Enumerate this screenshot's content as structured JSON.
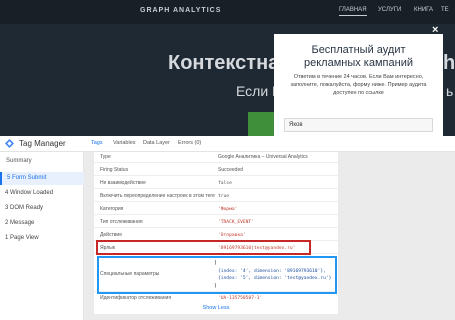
{
  "site": {
    "logo": "GRAPH ANALYTICS",
    "menu": [
      "ГЛАВНАЯ",
      "УСЛУГИ",
      "КНИГА",
      "ТЕ"
    ],
    "hero_title": "Контекстна",
    "hero_title_tail": "h",
    "hero_subtitle": "Если В",
    "hero_subtitle_tail": "ь"
  },
  "popup": {
    "close": "×",
    "heading_line1": "Бесплатный аудит",
    "heading_line2": "рекламных кампаний",
    "text_line1": "Ответим в течение 24 часов. Если Вам интересно,",
    "text_line2": "заполните, пожалуйста, форму ниже. Пример аудита",
    "text_line3": "доступен по ссылке",
    "input_value": "Яков"
  },
  "gtm": {
    "title": "Tag Manager",
    "tabs": [
      "Tags",
      "Variables",
      "Data Layer",
      "Errors (0)"
    ],
    "sidebar": {
      "summary": "Summary",
      "items": [
        {
          "num": "5",
          "label": "Form Submit"
        },
        {
          "num": "4",
          "label": "Window Loaded"
        },
        {
          "num": "3",
          "label": "DOM Ready"
        },
        {
          "num": "2",
          "label": "Message"
        },
        {
          "num": "1",
          "label": "Page View"
        }
      ]
    },
    "rows": [
      {
        "key": "Type",
        "value": "Google Аналитика – Universal Analytics"
      },
      {
        "key": "Firing Status",
        "value": "Succeeded"
      },
      {
        "key": "Не взаимодействие",
        "value": "false"
      },
      {
        "key": "Включить переопределение настроек в этом теге",
        "value": "true"
      },
      {
        "key": "Категория",
        "value": "'Форма'"
      },
      {
        "key": "Тип отслеживания",
        "value": "'TRACK_EVENT'"
      },
      {
        "key": "Действие",
        "value": "'Отправка'"
      },
      {
        "key": "Ярлык",
        "value": "'89169793610|test@yandex.ru'"
      }
    ],
    "special": {
      "key": "Специальные параметры",
      "line1": "[",
      "line2": "{index: '4', dimension: '89169793610'},",
      "line3": "{index: '5', dimension: 'test@yandex.ru'}",
      "line4": "]"
    },
    "tracking": {
      "key": "Идентификатор отслеживания",
      "value": "'UA-135758587-1'"
    },
    "show_less": "Show Less"
  }
}
